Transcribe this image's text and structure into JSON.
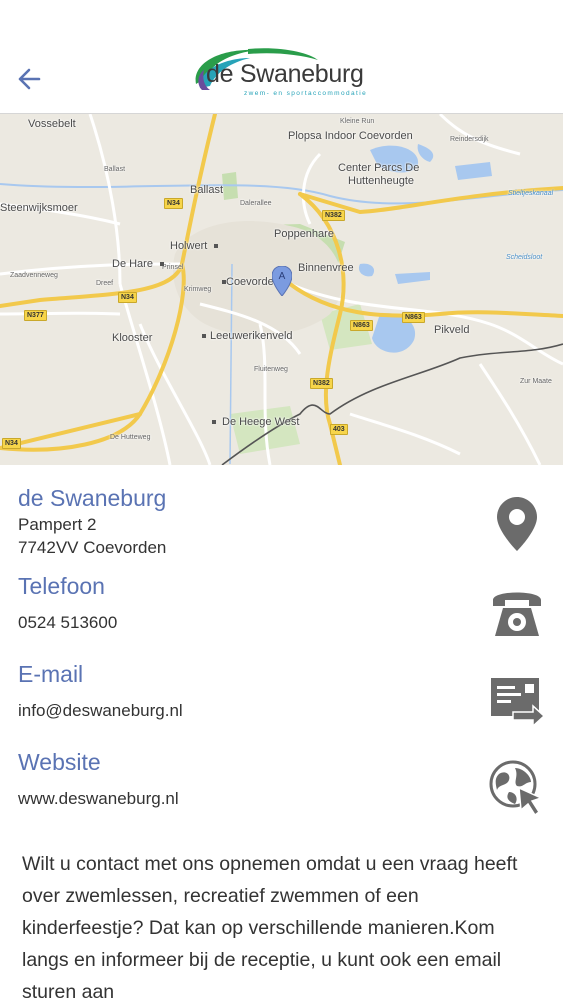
{
  "header": {
    "logo_text": "de Swaneburg",
    "logo_tagline": "zwem- en sportaccommodatie"
  },
  "map": {
    "places": [
      {
        "id": "vossebelt",
        "label": "Vossebelt"
      },
      {
        "id": "plopsa",
        "label": "Plopsa Indoor Coevorden"
      },
      {
        "id": "kleine-run",
        "label": "Kleine Run"
      },
      {
        "id": "center-parcs",
        "label": "Center Parcs De"
      },
      {
        "id": "center-parcs2",
        "label": "Huttenheugte"
      },
      {
        "id": "steenwijksmoer",
        "label": "Steenwijksmoer"
      },
      {
        "id": "ballast",
        "label": "Ballast"
      },
      {
        "id": "ballast-small",
        "label": "Ballast"
      },
      {
        "id": "holwert",
        "label": "Holwert"
      },
      {
        "id": "poppenhare",
        "label": "Poppenhare"
      },
      {
        "id": "de-hare",
        "label": "De Hare"
      },
      {
        "id": "coevorden",
        "label": "Coevorden"
      },
      {
        "id": "binnenvree",
        "label": "Binnenvree"
      },
      {
        "id": "klooster",
        "label": "Klooster"
      },
      {
        "id": "leeuwerikenveld",
        "label": "Leeuwerikenveld"
      },
      {
        "id": "pikveld",
        "label": "Pikveld"
      },
      {
        "id": "de-heege-west",
        "label": "De Heege West"
      },
      {
        "id": "reindersdijk",
        "label": "Reindersdijk"
      },
      {
        "id": "stieltjeskanaal",
        "label": "Stieltjeskanaal"
      },
      {
        "id": "scheidsloot",
        "label": "Scheidsloot"
      },
      {
        "id": "zur-maate",
        "label": "Zur Maate"
      },
      {
        "id": "zaadvenneweg",
        "label": "Zaadvenneweg"
      },
      {
        "id": "krimweg",
        "label": "Krimweg"
      },
      {
        "id": "de-hutteweg",
        "label": "De Hutteweg"
      },
      {
        "id": "dalerallee",
        "label": "Dalerallee"
      },
      {
        "id": "prinsel",
        "label": "Prinsel"
      },
      {
        "id": "dreef",
        "label": "Dreef"
      },
      {
        "id": "fluitenweg",
        "label": "Fluitenweg"
      }
    ],
    "roads": [
      "N34",
      "N382",
      "N34",
      "N377",
      "N863",
      "N863",
      "N382",
      "403",
      "N34"
    ],
    "marker_label": "A"
  },
  "contact": {
    "name_title": "de Swaneburg",
    "address_line1": "Pampert 2",
    "address_line2": "7742VV  Coevorden",
    "phone_title": "Telefoon",
    "phone": "0524 513600",
    "email_title": "E-mail",
    "email": "info@deswaneburg.nl",
    "website_title": "Website",
    "website": "www.deswaneburg.nl"
  },
  "intro_text": "Wilt u contact met ons opnemen omdat u een vraag heeft over zwemlessen, recreatief zwemmen of een kinderfeestje? Dat kan op verschillende manieren.Kom langs en informeer bij de receptie, u kunt  ook een email sturen aan",
  "colors": {
    "accent": "#5a73b3",
    "icon_gray": "#6b6b6b",
    "road_yellow": "#f7d54a",
    "water": "#a8c8ef",
    "park": "#c6deb0"
  }
}
